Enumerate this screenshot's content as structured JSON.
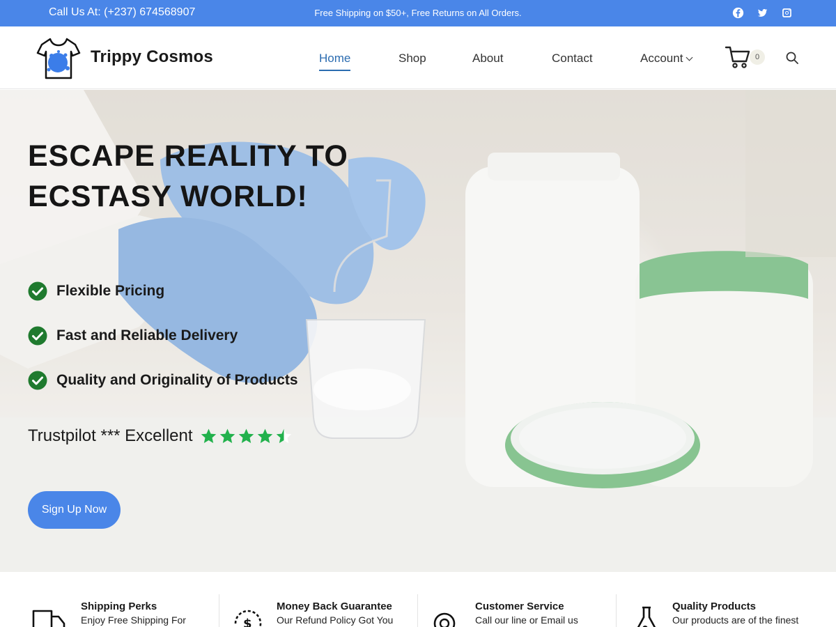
{
  "topbar": {
    "call": "Call Us At: (+237) 674568907",
    "promo": "Free Shipping on $50+, Free Returns on All Orders.",
    "socials": [
      "facebook-icon",
      "twitter-icon",
      "instagram-icon"
    ]
  },
  "header": {
    "brand": "Trippy Cosmos",
    "nav": [
      {
        "label": "Home",
        "active": true
      },
      {
        "label": "Shop"
      },
      {
        "label": "About"
      },
      {
        "label": "Contact"
      },
      {
        "label": "Account"
      }
    ],
    "cart_count": "0"
  },
  "hero": {
    "title_line1": "ESCAPE REALITY TO",
    "title_line2": "ECSTASY WORLD!",
    "features": [
      "Flexible Pricing",
      "Fast and Reliable Delivery",
      "Quality and Originality of Products"
    ],
    "trust_text": "Trustpilot *** Excellent",
    "rating": 4.5,
    "rating_max": 5,
    "cta": "Sign Up Now"
  },
  "perks": [
    {
      "title": "Shipping Perks",
      "desc": "Enjoy Free Shipping For"
    },
    {
      "title": "Money Back Guarantee",
      "desc": "Our Refund Policy Got You"
    },
    {
      "title": "Customer Service",
      "desc": "Call our line or Email us"
    },
    {
      "title": "Quality Products",
      "desc": "Our products are of the finest"
    }
  ],
  "colors": {
    "accent": "#4a86e8",
    "check_green": "#1f7a2e",
    "star_green": "#22b14c",
    "nav_active": "#2b6cb0"
  }
}
